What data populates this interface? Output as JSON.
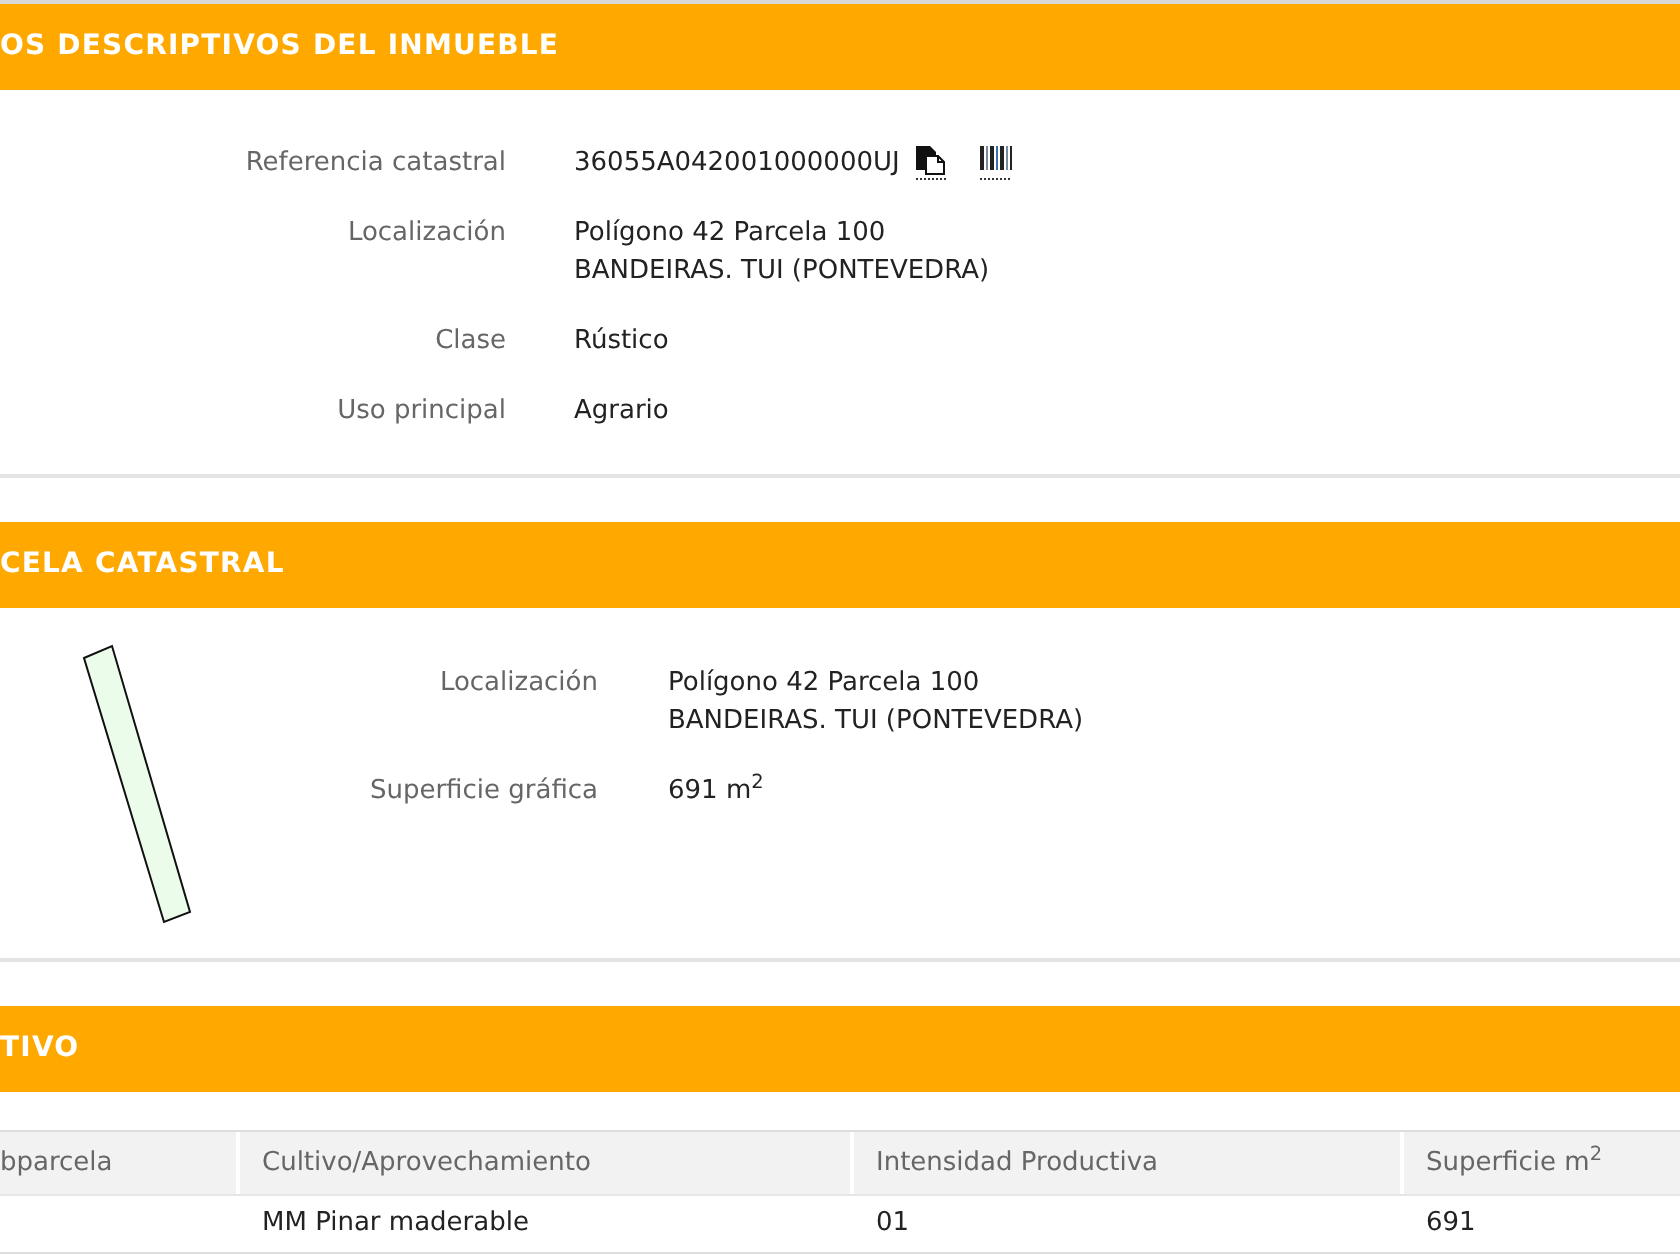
{
  "sections": [
    {
      "kind": "details",
      "title": "OS DESCRIPTIVOS DEL INMUEBLE",
      "fields": [
        {
          "label": "Referencia catastral",
          "lines": [
            "36055A042001000000UJ"
          ],
          "actions": [
            {
              "kind": "copy"
            },
            {
              "kind": "barcode"
            }
          ]
        },
        {
          "label": "Localización",
          "lines": [
            "Polígono 42 Parcela 100",
            "BANDEIRAS. TUI (PONTEVEDRA)"
          ]
        },
        {
          "label": "Clase",
          "lines": [
            "Rústico"
          ]
        },
        {
          "label": "Uso principal",
          "lines": [
            "Agrario"
          ]
        }
      ]
    },
    {
      "kind": "parcel",
      "title": "CELA CATASTRAL",
      "fields": [
        {
          "label": "Localización",
          "lines": [
            "Polígono 42 Parcela 100",
            "BANDEIRAS. TUI (PONTEVEDRA)"
          ]
        },
        {
          "label": "Superficie gráfica",
          "lines": [
            "691 m$^{2}$"
          ]
        }
      ]
    },
    {
      "kind": "table",
      "title": "TIVO",
      "columns": [
        "bparcela",
        "Cultivo/Aprovechamiento",
        "Intensidad Productiva",
        "Superficie m$^{2}$"
      ],
      "rows": [
        [
          null,
          "MM Pinar maderable",
          "01",
          "691"
        ]
      ]
    }
  ]
}
